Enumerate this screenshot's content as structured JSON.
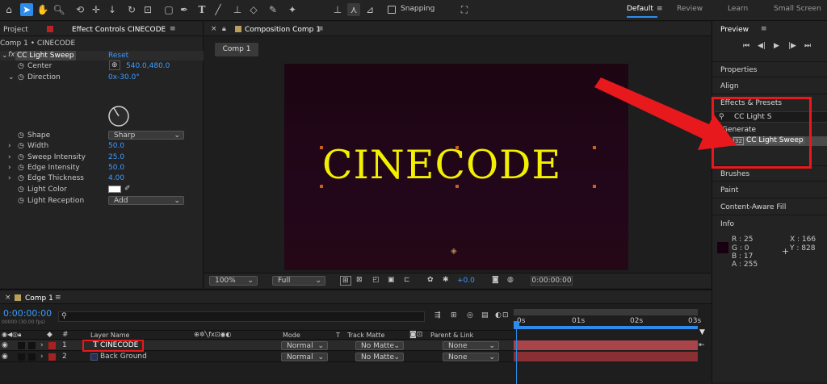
{
  "toolbar": {
    "snapping_label": "Snapping"
  },
  "workspaces": [
    "Default",
    "Review",
    "Learn",
    "Small Screen"
  ],
  "left_panel": {
    "tab_project": "Project",
    "tab_effect_controls": "Effect Controls CINECODE",
    "comp_layer_path": "Comp 1 • CINECODE",
    "effect_name": "CC Light Sweep",
    "reset_label": "Reset",
    "props": [
      {
        "name": "Center",
        "value": "540.0,480.0"
      },
      {
        "name": "Direction",
        "value": "0x-30.0°"
      },
      {
        "name": "Shape",
        "value": "Sharp"
      },
      {
        "name": "Width",
        "value": "50.0"
      },
      {
        "name": "Sweep Intensity",
        "value": "25.0"
      },
      {
        "name": "Edge Intensity",
        "value": "50.0"
      },
      {
        "name": "Edge Thickness",
        "value": "4.00"
      },
      {
        "name": "Light Color",
        "value": ""
      },
      {
        "name": "Light Reception",
        "value": "Add"
      }
    ]
  },
  "composition": {
    "tab_label": "Composition Comp 1",
    "comp_button": "Comp 1",
    "title_text": "CINECODE",
    "zoom": "100%",
    "resolution": "Full",
    "exposure": "+0.0",
    "timecode": "0:00:00:00"
  },
  "right_panel": {
    "preview": "Preview",
    "properties": "Properties",
    "align": "Align",
    "effects_presets": "Effects & Presets",
    "search_value": "CC Light S",
    "generate": "Generate",
    "effect_item": "CC Light Sweep",
    "brushes": "Brushes",
    "paint": "Paint",
    "content_aware_fill": "Content-Aware Fill",
    "info": "Info",
    "info_r": "R :  25",
    "info_g": "G :  0",
    "info_b": "B :  17",
    "info_a": "A :  255",
    "info_x": "X :  166",
    "info_y": "Y :  828",
    "colors": {
      "highlight": "#e8191c",
      "info_swatch": "#190011"
    }
  },
  "timeline": {
    "tab_label": "Comp 1",
    "timecode": "0:00:00:00",
    "fps_note": "00000 (30.00 fps)",
    "search_placeholder": "",
    "col_layer_name": "Layer Name",
    "col_mode": "Mode",
    "col_t": "T",
    "col_track_matte": "Track Matte",
    "col_parent_link": "Parent & Link",
    "ruler_labels": [
      "0s",
      "01s",
      "02s",
      "03s"
    ],
    "layers": [
      {
        "num": "1",
        "type": "T",
        "name": "CINECODE",
        "mode": "Normal",
        "matte": "No Matte",
        "parent": "None"
      },
      {
        "num": "2",
        "type": "",
        "name": "Back Ground",
        "mode": "Normal",
        "matte": "No Matte",
        "parent": "None"
      }
    ]
  },
  "colors": {
    "accent": "#2d8ceb",
    "text_yellow": "#f2f000",
    "comp_bg": "#200717"
  }
}
